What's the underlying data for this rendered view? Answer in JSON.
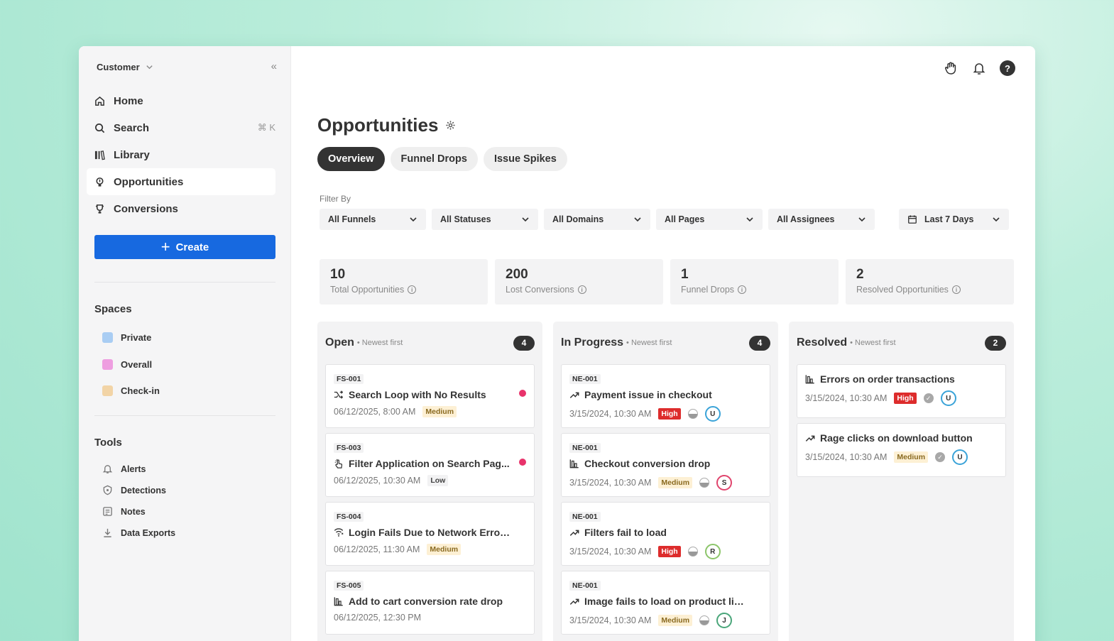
{
  "sidebar": {
    "workspace": "Customer",
    "nav": [
      {
        "label": "Home",
        "icon": "home-icon"
      },
      {
        "label": "Search",
        "icon": "search-icon",
        "shortcut": "⌘ K"
      },
      {
        "label": "Library",
        "icon": "library-icon"
      },
      {
        "label": "Opportunities",
        "icon": "lightbulb-icon",
        "active": true
      },
      {
        "label": "Conversions",
        "icon": "trophy-icon"
      }
    ],
    "create_label": "Create",
    "spaces_title": "Spaces",
    "spaces": [
      {
        "label": "Private",
        "color": "#a9cdf3"
      },
      {
        "label": "Overall",
        "color": "#ee9ee0"
      },
      {
        "label": "Check-in",
        "color": "#f2d4a6"
      }
    ],
    "tools_title": "Tools",
    "tools": [
      {
        "label": "Alerts",
        "icon": "bell-icon"
      },
      {
        "label": "Detections",
        "icon": "shield-icon"
      },
      {
        "label": "Notes",
        "icon": "notes-icon"
      },
      {
        "label": "Data Exports",
        "icon": "download-icon"
      }
    ]
  },
  "header": {
    "title": "Opportunities"
  },
  "tabs": [
    "Overview",
    "Funnel Drops",
    "Issue Spikes"
  ],
  "filters": {
    "label": "Filter By",
    "items": [
      "All Funnels",
      "All Statuses",
      "All Domains",
      "All Pages",
      "All Assignees"
    ],
    "date": "Last 7 Days"
  },
  "stats": [
    {
      "value": "10",
      "label": "Total Opportunities"
    },
    {
      "value": "200",
      "label": "Lost Conversions"
    },
    {
      "value": "1",
      "label": "Funnel Drops"
    },
    {
      "value": "2",
      "label": "Resolved Opportunities"
    }
  ],
  "columns": [
    {
      "title": "Open",
      "sort": "• Newest first",
      "count": "4",
      "cards": [
        {
          "id": "FS-001",
          "title": "Search Loop with No Results",
          "icon": "loop-icon",
          "date": "06/12/2025, 8:00 AM",
          "priority": "Medium",
          "dot": true
        },
        {
          "id": "FS-003",
          "title": "Filter Application on Search Pag...",
          "icon": "hand-click-icon",
          "date": "06/12/2025, 10:30 AM",
          "priority": "Low",
          "dot": true
        },
        {
          "id": "FS-004",
          "title": "Login Fails Due to Network Error on...",
          "icon": "wifi-icon",
          "date": "06/12/2025, 11:30 AM",
          "priority": "Medium"
        },
        {
          "id": "FS-005",
          "title": "Add to cart conversion rate drop",
          "icon": "funnel-chart-icon",
          "date": "06/12/2025, 12:30 PM",
          "priority": ""
        }
      ]
    },
    {
      "title": "In Progress",
      "sort": "• Newest first",
      "count": "4",
      "cards": [
        {
          "id": "NE-001",
          "title": "Payment issue in checkout",
          "icon": "trend-up-icon",
          "date": "3/15/2024, 10:30 AM",
          "priority": "High",
          "assignee": "U",
          "assignee_color": "#3aa3d8"
        },
        {
          "id": "NE-001",
          "title": "Checkout conversion drop",
          "icon": "funnel-chart-icon",
          "date": "3/15/2024, 10:30 AM",
          "priority": "Medium",
          "assignee": "S",
          "assignee_color": "#e0456d"
        },
        {
          "id": "NE-001",
          "title": "Filters fail to load",
          "icon": "trend-up-icon",
          "date": "3/15/2024, 10:30 AM",
          "priority": "High",
          "assignee": "R",
          "assignee_color": "#8cc56a"
        },
        {
          "id": "NE-001",
          "title": "Image fails to load on product listing",
          "icon": "trend-up-icon",
          "date": "3/15/2024, 10:30 AM",
          "priority": "Medium",
          "assignee": "J",
          "assignee_color": "#4aa67a"
        }
      ]
    },
    {
      "title": "Resolved",
      "sort": "• Newest first",
      "count": "2",
      "cards": [
        {
          "title": "Errors on order transactions",
          "icon": "funnel-chart-icon",
          "date": "3/15/2024, 10:30 AM",
          "priority": "High",
          "assignee": "U",
          "assignee_color": "#3aa3d8"
        },
        {
          "title": "Rage clicks on download button",
          "icon": "trend-up-icon",
          "date": "3/15/2024, 10:30 AM",
          "priority": "Medium",
          "assignee": "U",
          "assignee_color": "#3aa3d8"
        }
      ]
    }
  ],
  "colors": {
    "accent": "#1769e0",
    "high": "#dd2c2c",
    "dot": "#e8336b"
  }
}
